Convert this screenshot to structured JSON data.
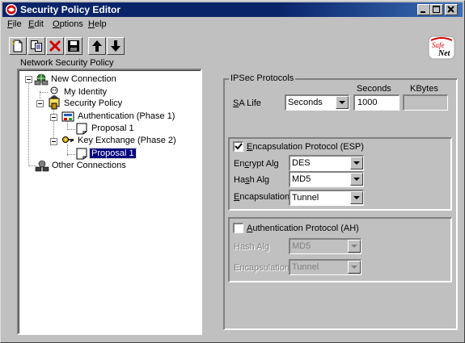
{
  "window": {
    "title": "Security Policy Editor",
    "caption_buttons": [
      "minimize",
      "maximize",
      "close"
    ]
  },
  "menu": [
    {
      "accel": "F",
      "rest": "ile"
    },
    {
      "accel": "E",
      "rest": "dit"
    },
    {
      "accel": "O",
      "rest": "ptions"
    },
    {
      "accel": "H",
      "rest": "elp"
    }
  ],
  "toolbar": {
    "icons": [
      "new-connection-icon",
      "copy-icon",
      "delete-icon",
      "save-icon",
      "move-up-icon",
      "move-down-icon"
    ]
  },
  "logo": {
    "text_top": "Safe",
    "text_bottom": "Net"
  },
  "tree": {
    "label": "Network Security Policy",
    "nodes": {
      "new_connection": "New Connection",
      "my_identity": "My Identity",
      "security_policy": "Security Policy",
      "authentication": "Authentication (Phase 1)",
      "auth_proposal": "Proposal 1",
      "key_exchange": "Key Exchange (Phase 2)",
      "kx_proposal": "Proposal 1",
      "other_connections": "Other Connections"
    },
    "selected": "kx_proposal"
  },
  "ipsec": {
    "group_title": "IPSec Protocols",
    "sa_life": {
      "label_accel": "S",
      "label_rest": "A Life",
      "units_value": "Seconds",
      "seconds_header": "Seconds",
      "kbytes_header": "KBytes",
      "seconds_value": "1000",
      "kbytes_value": ""
    },
    "esp": {
      "checked": true,
      "label_accel": "E",
      "label_rest": "ncapsulation Protocol (ESP)",
      "encrypt_label_pre": "En",
      "encrypt_label_accel": "c",
      "encrypt_label_post": "rypt Alg",
      "encrypt_value": "DES",
      "hash_label_pre": "Ha",
      "hash_label_accel": "s",
      "hash_label_post": "h Alg",
      "hash_value": "MD5",
      "encap_label_accel": "E",
      "encap_label_rest": "ncapsulation",
      "encap_value": "Tunnel"
    },
    "ah": {
      "checked": false,
      "label_accel": "A",
      "label_rest": "uthentication Protocol (AH)",
      "hash_label": "Hash Alg",
      "hash_value": "MD5",
      "encap_label": "Encapsulation",
      "encap_value": "Tunnel"
    }
  },
  "colors": {
    "title_bar": "#0a246a",
    "face": "#c0c0c0",
    "selection": "#000080"
  }
}
